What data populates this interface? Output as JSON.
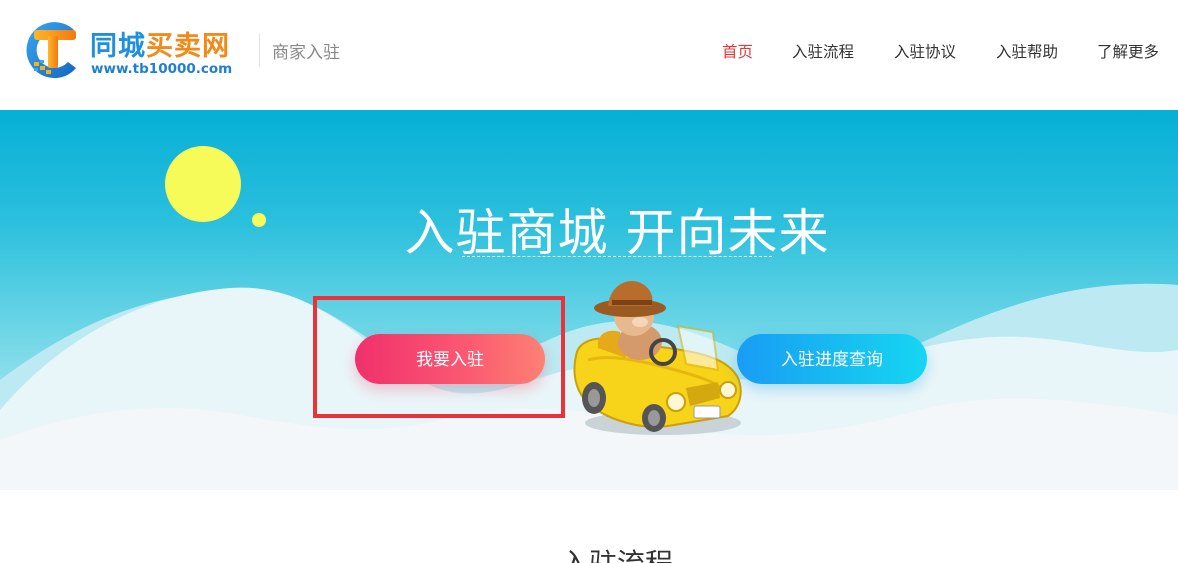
{
  "header": {
    "logo": {
      "name_part1": "同城",
      "name_part2": "买卖网",
      "url": "www.tb10000.com",
      "icon": "tb-logo-icon"
    },
    "subtitle": "商家入驻",
    "nav": [
      {
        "label": "首页",
        "active": true
      },
      {
        "label": "入驻流程",
        "active": false
      },
      {
        "label": "入驻协议",
        "active": false
      },
      {
        "label": "入驻帮助",
        "active": false
      },
      {
        "label": "了解更多",
        "active": false
      }
    ]
  },
  "hero": {
    "title": "入驻商城 开向未来",
    "join_button": "我要入驻",
    "progress_button": "入驻进度查询",
    "mascot_icon": "cartoon-driver-car-icon"
  },
  "section": {
    "title": "入驻流程"
  },
  "colors": {
    "nav_active": "#e03a3a",
    "join_gradient": [
      "#f0306c",
      "#fd8173"
    ],
    "progress_gradient": [
      "#199cf5",
      "#16d6f2"
    ],
    "hero_bg": "#06afd6",
    "highlight": "#e8333a"
  }
}
